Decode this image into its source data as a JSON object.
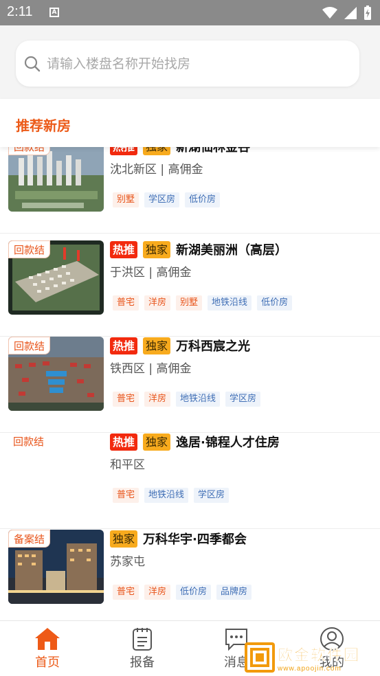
{
  "status_bar": {
    "time": "2:11",
    "notification_icon": "a-badge-icon",
    "icons": [
      "wifi-icon",
      "cellular-icon",
      "battery-charging-icon"
    ]
  },
  "search": {
    "placeholder": "请输入楼盘名称开始找房"
  },
  "section": {
    "title": "推荐新房"
  },
  "listings": [
    {
      "corner": "回款结",
      "hot": "热推",
      "exclusive": "独家",
      "name": "新湖仙林金谷",
      "district": "沈北新区",
      "commission": "| 高佣金",
      "tags": [
        {
          "text": "别墅",
          "color": "orange"
        },
        {
          "text": "学区房",
          "color": "blue"
        },
        {
          "text": "低价房",
          "color": "blue"
        }
      ]
    },
    {
      "corner": "回款结",
      "hot": "热推",
      "exclusive": "独家",
      "name": "新湖美丽洲（高层）",
      "district": "于洪区",
      "commission": "| 高佣金",
      "tags": [
        {
          "text": "普宅",
          "color": "orange"
        },
        {
          "text": "洋房",
          "color": "orange"
        },
        {
          "text": "别墅",
          "color": "orange"
        },
        {
          "text": "地铁沿线",
          "color": "blue"
        },
        {
          "text": "低价房",
          "color": "blue"
        }
      ]
    },
    {
      "corner": "回款结",
      "hot": "热推",
      "exclusive": "独家",
      "name": "万科西宸之光",
      "district": "铁西区",
      "commission": "| 高佣金",
      "tags": [
        {
          "text": "普宅",
          "color": "orange"
        },
        {
          "text": "洋房",
          "color": "orange"
        },
        {
          "text": "地铁沿线",
          "color": "blue"
        },
        {
          "text": "学区房",
          "color": "blue"
        }
      ]
    },
    {
      "corner": "回款结",
      "hot": "热推",
      "exclusive": "独家",
      "name": "逸居·锦程人才住房",
      "district": "和平区",
      "commission": "",
      "tags": [
        {
          "text": "普宅",
          "color": "orange"
        },
        {
          "text": "地铁沿线",
          "color": "blue"
        },
        {
          "text": "学区房",
          "color": "blue"
        }
      ]
    },
    {
      "corner": "备案结",
      "hot": "",
      "exclusive": "独家",
      "name": "万科华宇·四季都会",
      "district": "苏家屯",
      "commission": "",
      "tags": [
        {
          "text": "普宅",
          "color": "orange"
        },
        {
          "text": "洋房",
          "color": "orange"
        },
        {
          "text": "低价房",
          "color": "blue"
        },
        {
          "text": "品牌房",
          "color": "blue"
        }
      ]
    }
  ],
  "tabbar": {
    "tabs": [
      {
        "label": "首页",
        "icon": "home-icon",
        "active": true
      },
      {
        "label": "报备",
        "icon": "clipboard-icon",
        "active": false
      },
      {
        "label": "消息",
        "icon": "message-icon",
        "active": false
      },
      {
        "label": "我的",
        "icon": "user-icon",
        "active": false
      }
    ]
  },
  "watermark": {
    "title": "欧金软件园",
    "subtitle": "www.apoojin.com"
  },
  "colors": {
    "accent": "#ec5a18",
    "hot_badge": "#f22a0e",
    "exclusive_badge": "#f8ab1e",
    "tag_blue": "#3f6eb5"
  }
}
